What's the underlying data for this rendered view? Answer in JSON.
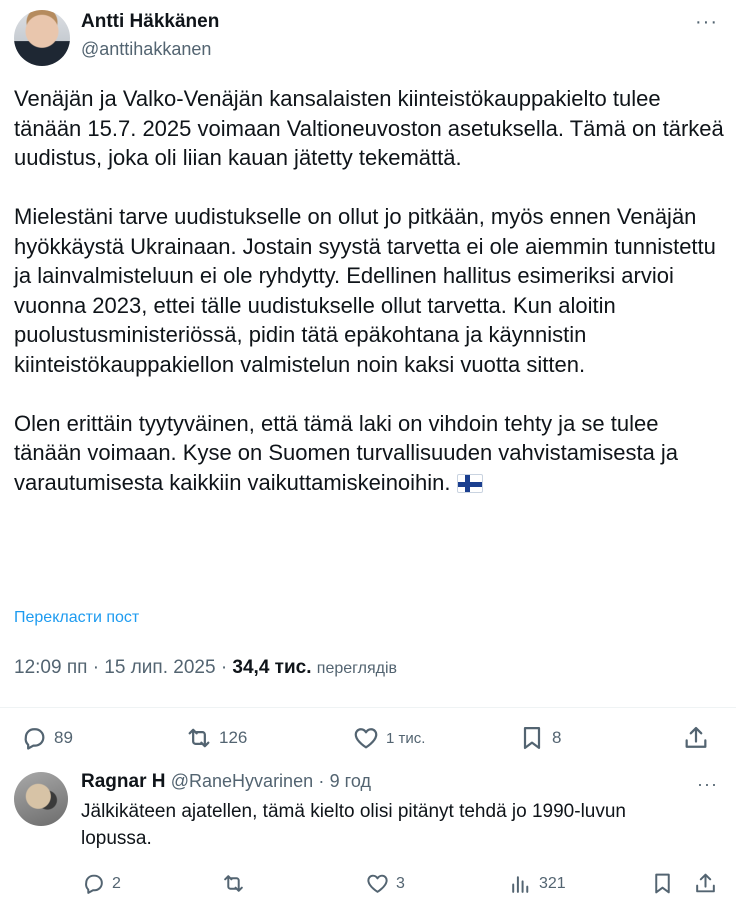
{
  "tweet": {
    "author_name": "Antti Häkkänen",
    "author_handle": "@anttihakkanen",
    "more_label": "···",
    "paragraphs": [
      "Venäjän ja Valko-Venäjän kansalaisten kiinteistökauppakielto tulee tänään 15.7. 2025 voimaan Valtioneuvoston asetuksella. Tämä on tärkeä uudistus, joka oli liian kauan jätetty tekemättä.",
      "Mielestäni tarve uudistukselle on ollut jo pitkään, myös ennen Venäjän hyökkäystä Ukrainaan. Jostain syystä tarvetta ei ole aiemmin tunnistettu ja lainvalmisteluun ei ole ryhdytty. Edellinen hallitus esimeriksi arvioi vuonna 2023, ettei tälle uudistukselle ollut tarvetta. Kun aloitin puolustusministeriössä, pidin tätä epäkohtana ja käynnistin kiinteistökauppakiellon valmistelun noin kaksi vuotta sitten.",
      "Olen erittäin tyytyväinen, että tämä laki on vihdoin tehty ja se tulee tänään voimaan. Kyse on Suomen turvallisuuden vahvistamisesta ja varautumisesta kaikkiin vaikuttamiskeinoihin."
    ],
    "flag_icon": "finland-flag-icon",
    "translate_label": "Перекласти пост",
    "time": "12:09 пп",
    "date": "15 лип. 2025",
    "separator": "·",
    "views_count": "34,4 тис.",
    "views_label": "переглядів",
    "actions": {
      "replies": "89",
      "reposts": "126",
      "likes": "1 тис.",
      "bookmarks": "8"
    }
  },
  "reply": {
    "name": "Ragnar H",
    "handle": "@RaneHyvarinen",
    "separator": "·",
    "time": "9 год",
    "more_label": "···",
    "text": "Jälkikäteen ajatellen, tämä kielto olisi pitänyt tehdä jo 1990-luvun lopussa.",
    "actions": {
      "replies": "2",
      "reposts": "",
      "likes": "3",
      "views": "321"
    }
  },
  "colors": {
    "text": "#0f1419",
    "secondary": "#536471",
    "link": "#1d9bf0",
    "divider": "#eff3f4"
  }
}
